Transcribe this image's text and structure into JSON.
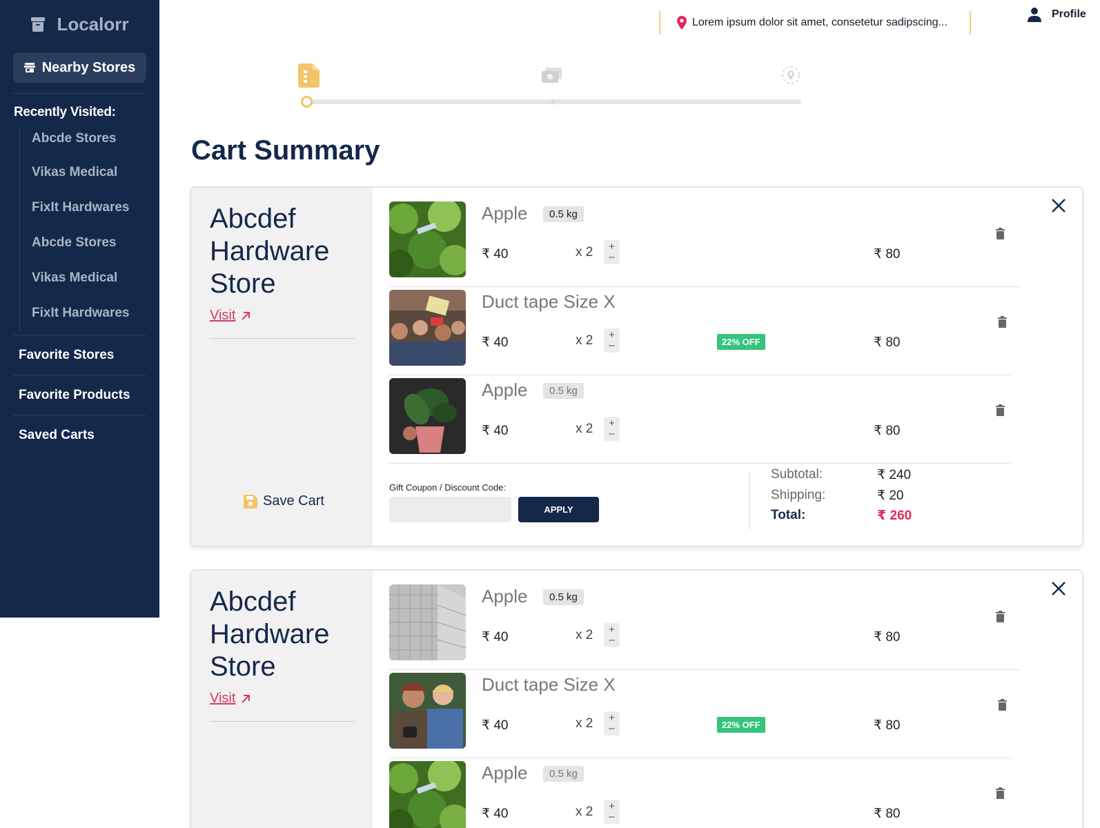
{
  "app": {
    "name": "Localorr",
    "logo_icon": "archive-icon"
  },
  "sidebar": {
    "nearby_label": "Nearby Stores",
    "recent_title": "Recently Visited:",
    "recent": [
      "Abcde Stores",
      "Vikas Medical",
      "FixIt Hardwares",
      "Abcde Stores",
      "Vikas Medical",
      "FixIt Hardwares"
    ],
    "links": [
      "Favorite Stores",
      "Favorite Products",
      "Saved Carts"
    ]
  },
  "header": {
    "location": "Lorem ipsum dolor sit amet, consetetur sadipscing...",
    "profile_label": "Profile"
  },
  "stepper": {
    "steps": [
      "cart-icon",
      "payment-icon",
      "location-icon"
    ],
    "current": 1,
    "accent": "#f2c46a"
  },
  "page_title": "Cart Summary",
  "carts": [
    {
      "store": "Abcdef Hardware Store",
      "visit_label": "Visit",
      "save_label": "Save Cart",
      "items": [
        {
          "name": "Apple",
          "weight": "0.5 kg",
          "price": "₹ 40",
          "qty": "x 2",
          "total": "₹ 80",
          "discount": "",
          "thumb": "greenery"
        },
        {
          "name": "Duct tape Size X",
          "weight": "",
          "price": "₹ 40",
          "qty": "x 2",
          "total": "₹ 80",
          "discount": "22% OFF",
          "thumb": "crowd"
        },
        {
          "name": "Apple",
          "weight": "0.5 kg",
          "price": "₹ 40",
          "qty": "x 2",
          "total": "₹ 80",
          "discount": "",
          "thumb": "plant"
        }
      ],
      "coupon_label": "Gift Coupon / Discount Code:",
      "coupon_value": "",
      "apply_label": "APPLY",
      "subtotal_label": "Subtotal:",
      "subtotal": "₹ 240",
      "shipping_label": "Shipping:",
      "shipping": "₹ 20",
      "total_label": "Total:",
      "total": "₹ 260"
    },
    {
      "store": "Abcdef Hardware Store",
      "visit_label": "Visit",
      "items": [
        {
          "name": "Apple",
          "weight": "0.5 kg",
          "price": "₹ 40",
          "qty": "x 2",
          "total": "₹ 80",
          "discount": "",
          "thumb": "building"
        },
        {
          "name": "Duct tape Size X",
          "weight": "",
          "price": "₹ 40",
          "qty": "x 2",
          "total": "₹ 80",
          "discount": "22% OFF",
          "thumb": "couple"
        },
        {
          "name": "Apple",
          "weight": "0.5 kg",
          "price": "₹ 40",
          "qty": "x 2",
          "total": "₹ 80",
          "discount": "",
          "thumb": "greenery"
        }
      ]
    }
  ],
  "colors": {
    "sidebar_bg": "#14284a",
    "accent_red": "#e3285a",
    "badge_green": "#34c47b",
    "step_yellow": "#f2c46a"
  }
}
